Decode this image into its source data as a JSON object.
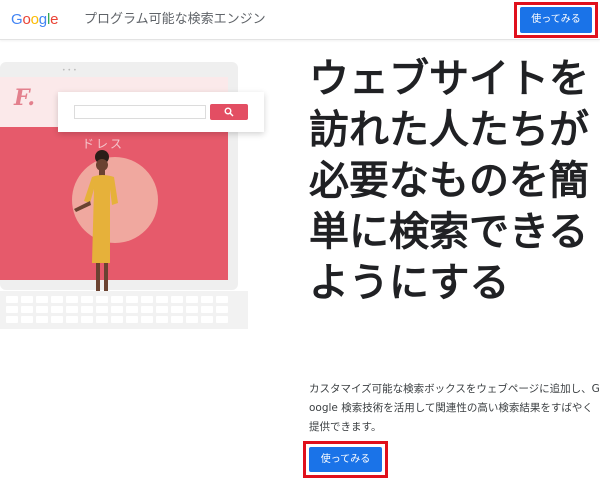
{
  "header": {
    "logo_letters": [
      "G",
      "o",
      "o",
      "g",
      "l",
      "e"
    ],
    "logo_colors": [
      "#4285F4",
      "#EA4335",
      "#FBBC05",
      "#4285F4",
      "#34A853",
      "#EA4335"
    ],
    "product_name": "プログラム可能な検索エンジン",
    "cta_label": "使ってみる"
  },
  "hero": {
    "headline": "ウェブサイトを訪れた人たちが必要なものを簡単に検索できるようにする",
    "description": "カスタマイズ可能な検索ボックスをウェブページに追加し、Google 検索技術を活用して関連性の高い検索結果をすばやく提供できます。",
    "cta_label": "使ってみる"
  },
  "illustration": {
    "brand_letter": "F.",
    "faint_text": "ドレス",
    "search_icon": "search-icon",
    "colors": {
      "screen_pink": "#e65a6b",
      "circle": "#f0a89f",
      "search_button": "#e34e63"
    }
  },
  "theme": {
    "primary": "#1a73e8",
    "highlight_frame": "#e0101c"
  }
}
